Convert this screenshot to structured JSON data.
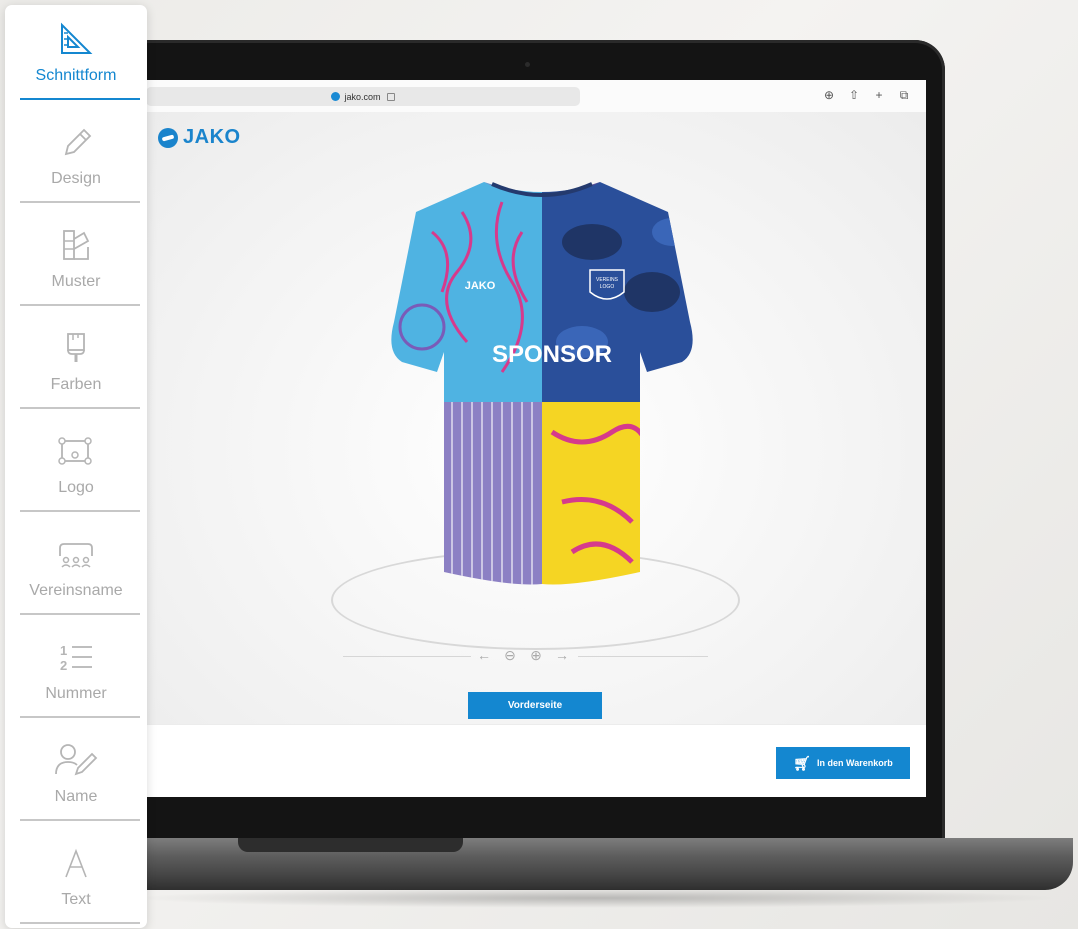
{
  "sidebar": {
    "items": [
      {
        "label": "Schnittform",
        "icon": "set-square-icon",
        "active": true
      },
      {
        "label": "Design",
        "icon": "pencil-icon",
        "active": false
      },
      {
        "label": "Muster",
        "icon": "swatches-icon",
        "active": false
      },
      {
        "label": "Farben",
        "icon": "paint-brush-icon",
        "active": false
      },
      {
        "label": "Logo",
        "icon": "logo-frame-icon",
        "active": false
      },
      {
        "label": "Vereinsname",
        "icon": "team-icon",
        "active": false
      },
      {
        "label": "Nummer",
        "icon": "numbered-list-icon",
        "active": false
      },
      {
        "label": "Name",
        "icon": "user-edit-icon",
        "active": false
      },
      {
        "label": "Text",
        "icon": "text-icon",
        "active": false
      }
    ]
  },
  "browser": {
    "url": "jako.com"
  },
  "brand": "JAKO",
  "jersey": {
    "chest_brand": "JAKO",
    "badge_line1": "VEREINS",
    "badge_line2": "LOGO",
    "sponsor": "SPONSOR"
  },
  "view": {
    "side_button": "Vorderseite"
  },
  "footer": {
    "cart_button": "In den Warenkorb"
  },
  "colors": {
    "accent": "#1487d0",
    "sky": "#4fb3e2",
    "navy": "#2a4f9a",
    "magenta": "#d63a8c",
    "yellow": "#f5d523",
    "lilac": "#8c80c4"
  }
}
